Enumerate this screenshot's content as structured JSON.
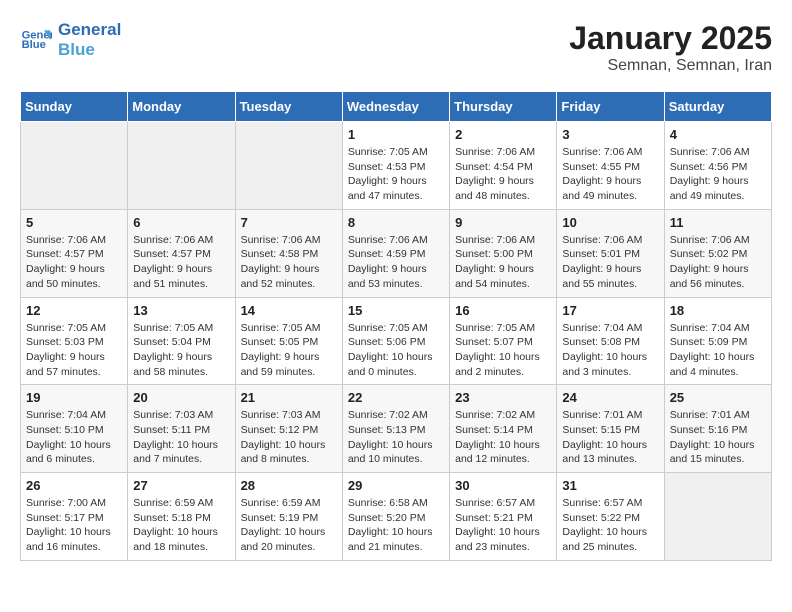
{
  "header": {
    "logo_line1": "General",
    "logo_line2": "Blue",
    "month_year": "January 2025",
    "location": "Semnan, Semnan, Iran"
  },
  "weekdays": [
    "Sunday",
    "Monday",
    "Tuesday",
    "Wednesday",
    "Thursday",
    "Friday",
    "Saturday"
  ],
  "weeks": [
    [
      {
        "day": "",
        "info": ""
      },
      {
        "day": "",
        "info": ""
      },
      {
        "day": "",
        "info": ""
      },
      {
        "day": "1",
        "info": "Sunrise: 7:05 AM\nSunset: 4:53 PM\nDaylight: 9 hours and 47 minutes."
      },
      {
        "day": "2",
        "info": "Sunrise: 7:06 AM\nSunset: 4:54 PM\nDaylight: 9 hours and 48 minutes."
      },
      {
        "day": "3",
        "info": "Sunrise: 7:06 AM\nSunset: 4:55 PM\nDaylight: 9 hours and 49 minutes."
      },
      {
        "day": "4",
        "info": "Sunrise: 7:06 AM\nSunset: 4:56 PM\nDaylight: 9 hours and 49 minutes."
      }
    ],
    [
      {
        "day": "5",
        "info": "Sunrise: 7:06 AM\nSunset: 4:57 PM\nDaylight: 9 hours and 50 minutes."
      },
      {
        "day": "6",
        "info": "Sunrise: 7:06 AM\nSunset: 4:57 PM\nDaylight: 9 hours and 51 minutes."
      },
      {
        "day": "7",
        "info": "Sunrise: 7:06 AM\nSunset: 4:58 PM\nDaylight: 9 hours and 52 minutes."
      },
      {
        "day": "8",
        "info": "Sunrise: 7:06 AM\nSunset: 4:59 PM\nDaylight: 9 hours and 53 minutes."
      },
      {
        "day": "9",
        "info": "Sunrise: 7:06 AM\nSunset: 5:00 PM\nDaylight: 9 hours and 54 minutes."
      },
      {
        "day": "10",
        "info": "Sunrise: 7:06 AM\nSunset: 5:01 PM\nDaylight: 9 hours and 55 minutes."
      },
      {
        "day": "11",
        "info": "Sunrise: 7:06 AM\nSunset: 5:02 PM\nDaylight: 9 hours and 56 minutes."
      }
    ],
    [
      {
        "day": "12",
        "info": "Sunrise: 7:05 AM\nSunset: 5:03 PM\nDaylight: 9 hours and 57 minutes."
      },
      {
        "day": "13",
        "info": "Sunrise: 7:05 AM\nSunset: 5:04 PM\nDaylight: 9 hours and 58 minutes."
      },
      {
        "day": "14",
        "info": "Sunrise: 7:05 AM\nSunset: 5:05 PM\nDaylight: 9 hours and 59 minutes."
      },
      {
        "day": "15",
        "info": "Sunrise: 7:05 AM\nSunset: 5:06 PM\nDaylight: 10 hours and 0 minutes."
      },
      {
        "day": "16",
        "info": "Sunrise: 7:05 AM\nSunset: 5:07 PM\nDaylight: 10 hours and 2 minutes."
      },
      {
        "day": "17",
        "info": "Sunrise: 7:04 AM\nSunset: 5:08 PM\nDaylight: 10 hours and 3 minutes."
      },
      {
        "day": "18",
        "info": "Sunrise: 7:04 AM\nSunset: 5:09 PM\nDaylight: 10 hours and 4 minutes."
      }
    ],
    [
      {
        "day": "19",
        "info": "Sunrise: 7:04 AM\nSunset: 5:10 PM\nDaylight: 10 hours and 6 minutes."
      },
      {
        "day": "20",
        "info": "Sunrise: 7:03 AM\nSunset: 5:11 PM\nDaylight: 10 hours and 7 minutes."
      },
      {
        "day": "21",
        "info": "Sunrise: 7:03 AM\nSunset: 5:12 PM\nDaylight: 10 hours and 8 minutes."
      },
      {
        "day": "22",
        "info": "Sunrise: 7:02 AM\nSunset: 5:13 PM\nDaylight: 10 hours and 10 minutes."
      },
      {
        "day": "23",
        "info": "Sunrise: 7:02 AM\nSunset: 5:14 PM\nDaylight: 10 hours and 12 minutes."
      },
      {
        "day": "24",
        "info": "Sunrise: 7:01 AM\nSunset: 5:15 PM\nDaylight: 10 hours and 13 minutes."
      },
      {
        "day": "25",
        "info": "Sunrise: 7:01 AM\nSunset: 5:16 PM\nDaylight: 10 hours and 15 minutes."
      }
    ],
    [
      {
        "day": "26",
        "info": "Sunrise: 7:00 AM\nSunset: 5:17 PM\nDaylight: 10 hours and 16 minutes."
      },
      {
        "day": "27",
        "info": "Sunrise: 6:59 AM\nSunset: 5:18 PM\nDaylight: 10 hours and 18 minutes."
      },
      {
        "day": "28",
        "info": "Sunrise: 6:59 AM\nSunset: 5:19 PM\nDaylight: 10 hours and 20 minutes."
      },
      {
        "day": "29",
        "info": "Sunrise: 6:58 AM\nSunset: 5:20 PM\nDaylight: 10 hours and 21 minutes."
      },
      {
        "day": "30",
        "info": "Sunrise: 6:57 AM\nSunset: 5:21 PM\nDaylight: 10 hours and 23 minutes."
      },
      {
        "day": "31",
        "info": "Sunrise: 6:57 AM\nSunset: 5:22 PM\nDaylight: 10 hours and 25 minutes."
      },
      {
        "day": "",
        "info": ""
      }
    ]
  ]
}
